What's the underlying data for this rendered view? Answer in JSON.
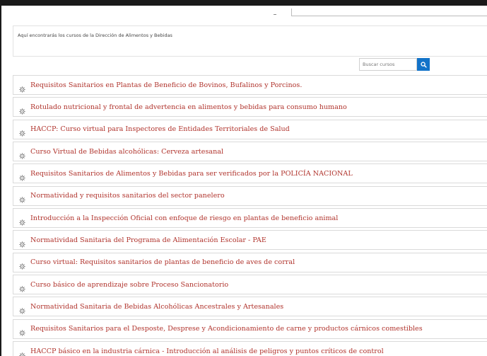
{
  "intro": {
    "text": "Aquí encontrarás los cursos de la Dirección de Alimentos y Bebidas"
  },
  "search": {
    "placeholder": "Buscar cursos",
    "icon": "search-icon",
    "button_color": "#1273c9"
  },
  "colors": {
    "course_link": "#b0332c",
    "border": "#dadada"
  },
  "courses": [
    {
      "title": "Requisitos Sanitarios en Plantas de Beneficio de Bovinos, Bufalinos y Porcinos.",
      "icon": "course-gear-icon"
    },
    {
      "title": "Rotulado nutricional y frontal de advertencia en alimentos y bebidas para consumo humano",
      "icon": "course-gear-icon"
    },
    {
      "title": "HACCP: Curso virtual para Inspectores de Entidades Territoriales de Salud",
      "icon": "course-gear-icon"
    },
    {
      "title": "Curso Virtual de Bebidas alcohólicas: Cerveza artesanal",
      "icon": "course-gear-icon"
    },
    {
      "title": "Requisitos Sanitarios de Alimentos y Bebidas para ser verificados por la POLICÍA NACIONAL",
      "icon": "course-gear-icon"
    },
    {
      "title": "Normatividad y requisitos sanitarios del sector panelero",
      "icon": "course-gear-icon"
    },
    {
      "title": "Introducción a la Inspección Oficial con enfoque de riesgo en plantas de beneficio animal",
      "icon": "course-gear-icon"
    },
    {
      "title": "Normatividad Sanitaria del Programa de Alimentación Escolar - PAE",
      "icon": "course-gear-icon"
    },
    {
      "title": "Curso virtual: Requisitos sanitarios de plantas de beneficio de aves de corral",
      "icon": "course-gear-icon"
    },
    {
      "title": "Curso básico de aprendizaje sobre Proceso Sancionatorio",
      "icon": "course-gear-icon"
    },
    {
      "title": "Normatividad Sanitaria de Bebidas Alcohólicas Ancestrales y Artesanales",
      "icon": "course-gear-icon"
    },
    {
      "title": "Requisitos Sanitarios para el Desposte, Desprese y Acondicionamiento de carne y productos cárnicos comestibles",
      "icon": "course-gear-icon"
    },
    {
      "title": "HACCP básico en la industria cárnica - Introducción al análisis de peligros y puntos críticos de control",
      "icon": "course-gear-icon"
    }
  ]
}
